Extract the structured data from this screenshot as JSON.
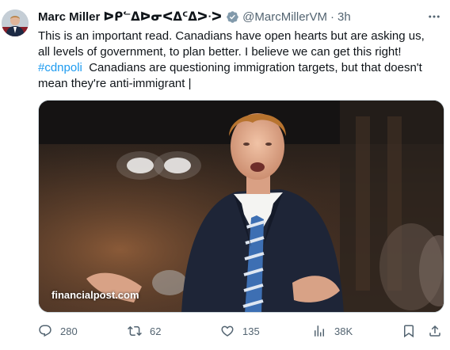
{
  "author": {
    "name": "Marc Miller ᐅᑭᓪᐃᐅᓂᐸᐃᑦᐃᐳᐧᐳ",
    "handle": "@MarcMillerVM",
    "separator": "·",
    "time": "3h"
  },
  "tweet": {
    "line1": "This is an important read. Canadians have open hearts but are asking us,",
    "line2": "all levels of government, to plan better. I believe we can get this right!",
    "hashtag": "#cdnpoli",
    "line3_rest": "  Canadians are questioning immigration targets, but that doesn't",
    "line4": "mean they're anti-immigrant |"
  },
  "media": {
    "watermark": "financialpost.com"
  },
  "actions": {
    "replies": "280",
    "reposts": "62",
    "likes": "135",
    "views": "38K"
  },
  "colors": {
    "link": "#1d9bf0",
    "secondary_text": "#536471",
    "verified_badge": "#829aab"
  }
}
